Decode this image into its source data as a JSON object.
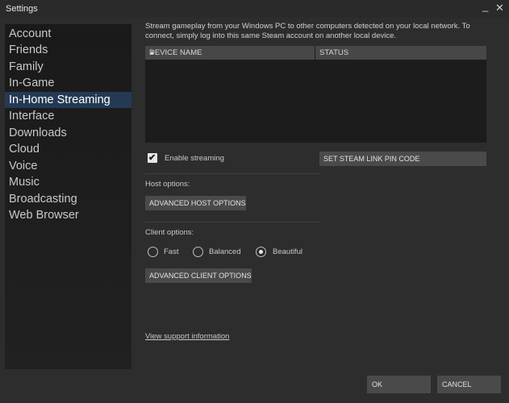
{
  "window": {
    "title": "Settings",
    "minimize_glyph": "_",
    "close_glyph": "✕"
  },
  "sidebar": {
    "items": [
      {
        "label": "Account",
        "active": false
      },
      {
        "label": "Friends",
        "active": false
      },
      {
        "label": "Family",
        "active": false
      },
      {
        "label": "In-Game",
        "active": false
      },
      {
        "label": "In-Home Streaming",
        "active": true
      },
      {
        "label": "Interface",
        "active": false
      },
      {
        "label": "Downloads",
        "active": false
      },
      {
        "label": "Cloud",
        "active": false
      },
      {
        "label": "Voice",
        "active": false
      },
      {
        "label": "Music",
        "active": false
      },
      {
        "label": "Broadcasting",
        "active": false
      },
      {
        "label": "Web Browser",
        "active": false
      }
    ]
  },
  "main": {
    "description": "Stream gameplay from your Windows PC to other computers detected on your local network. To connect, simply log into this same Steam account on another local device.",
    "table": {
      "columns": [
        "DEVICE NAME",
        "STATUS"
      ],
      "sort_indicator": "▲",
      "rows": []
    },
    "enable_streaming": {
      "label": "Enable streaming",
      "checked": true,
      "check_glyph": "✔"
    },
    "pin_button": "SET STEAM LINK PIN CODE",
    "host_options": {
      "label": "Host options:",
      "button": "ADVANCED HOST OPTIONS"
    },
    "client_options": {
      "label": "Client options:",
      "radios": [
        {
          "label": "Fast",
          "selected": false
        },
        {
          "label": "Balanced",
          "selected": false
        },
        {
          "label": "Beautiful",
          "selected": true
        }
      ],
      "button": "ADVANCED CLIENT OPTIONS"
    },
    "support_link": "View support information"
  },
  "footer": {
    "ok": "OK",
    "cancel": "CANCEL"
  },
  "colors": {
    "window_bg": "#2d2d2d",
    "sidebar_bg": "#1c1c1c",
    "active_item": "#243a54",
    "button_bg": "#4a4a4a",
    "table_bg": "#1c1c1c"
  }
}
